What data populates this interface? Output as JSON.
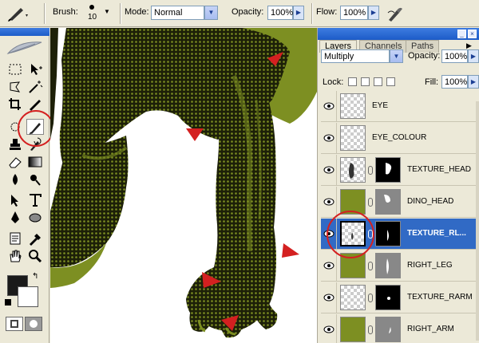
{
  "options_bar": {
    "brush_label": "Brush:",
    "brush_size": "10",
    "mode_label": "Mode:",
    "mode_value": "Normal",
    "opacity_label": "Opacity:",
    "opacity_value": "100%",
    "flow_label": "Flow:",
    "flow_value": "100%"
  },
  "layers_panel": {
    "tabs": [
      {
        "label": "Layers"
      },
      {
        "label": "Channels"
      },
      {
        "label": "Paths"
      }
    ],
    "blend_mode": "Multiply",
    "opacity_label": "Opacity:",
    "opacity_value": "100%",
    "lock_label": "Lock:",
    "fill_label": "Fill:",
    "fill_value": "100%",
    "layers": [
      {
        "name": "EYE",
        "selected": false
      },
      {
        "name": "EYE_COLOUR",
        "selected": false
      },
      {
        "name": "TEXTURE_HEAD",
        "selected": false
      },
      {
        "name": "DINO_HEAD",
        "selected": false
      },
      {
        "name": "TEXTURE_RL...",
        "selected": true
      },
      {
        "name": "RIGHT_LEG",
        "selected": false
      },
      {
        "name": "TEXTURE_RARM",
        "selected": false
      },
      {
        "name": "RIGHT_ARM",
        "selected": false
      }
    ]
  },
  "colors": {
    "dino_green": "#7d8f22",
    "dino_dark": "#1d2008",
    "selection_blue": "#316ac5",
    "annotation_red": "#d42020",
    "title_bar_blue": "#1d5cc8"
  },
  "icons": {
    "brush_tool": "brush-icon",
    "visibility": "eye-icon",
    "link": "chain-link-icon"
  }
}
